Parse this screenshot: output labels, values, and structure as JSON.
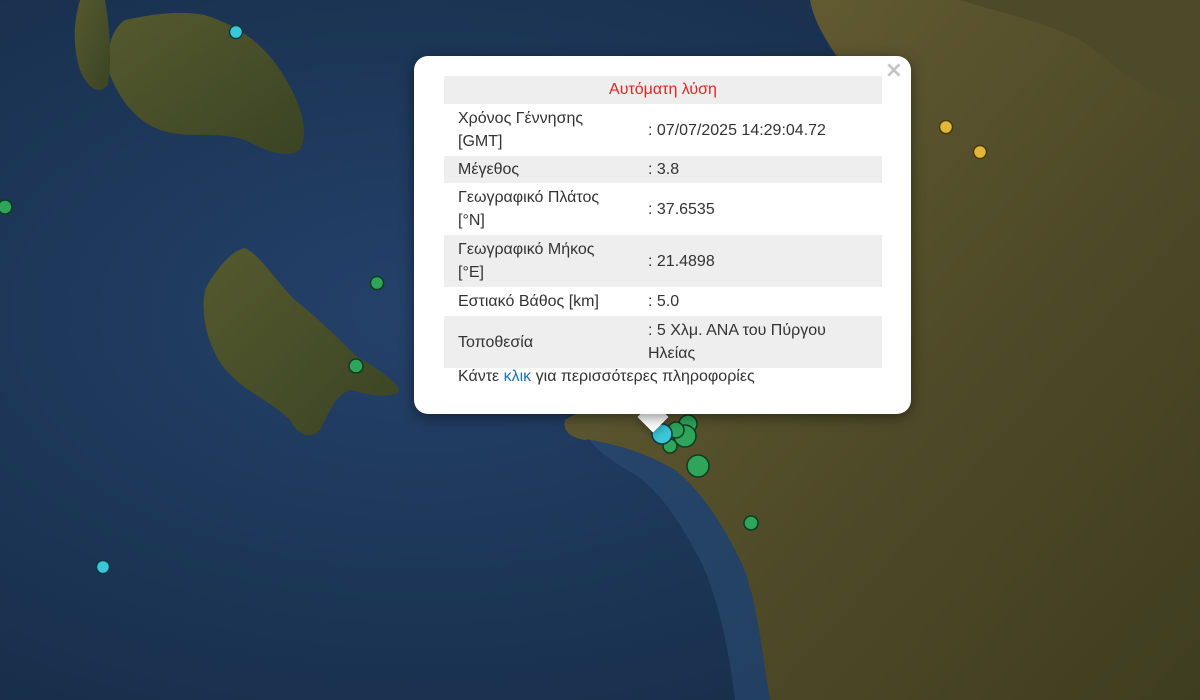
{
  "popup": {
    "title": "Αυτόματη λύση",
    "close_symbol": "×",
    "rows": [
      {
        "label": "Χρόνος Γέννησης [GMT]",
        "value": ": 07/07/2025 14:29:04.72"
      },
      {
        "label": "Μέγεθος",
        "value": ": 3.8"
      },
      {
        "label": "Γεωγραφικό Πλάτος [°N]",
        "value": ": 37.6535"
      },
      {
        "label": "Γεωγραφικό Μήκος [°E]",
        "value": ": 21.4898"
      },
      {
        "label": "Εστιακό Βάθος [km]",
        "value": ": 5.0"
      },
      {
        "label": "Τοποθεσία",
        "value": ": 5 Χλμ. ΑΝΑ του Πύργου Ηλείας"
      }
    ],
    "more_prefix": "Κάντε ",
    "more_link": "κλικ",
    "more_suffix": " για περισσότερες πληροφορίες"
  },
  "colors": {
    "sea": "#1f3a5a",
    "land": "#5b5430",
    "quake_green": "#2ea55a",
    "quake_cyan": "#3ac8d8",
    "quake_yellow": "#e2b737",
    "title_red": "#e8231e",
    "link_blue": "#1a74b8"
  },
  "icons": {
    "close": "close-icon"
  }
}
